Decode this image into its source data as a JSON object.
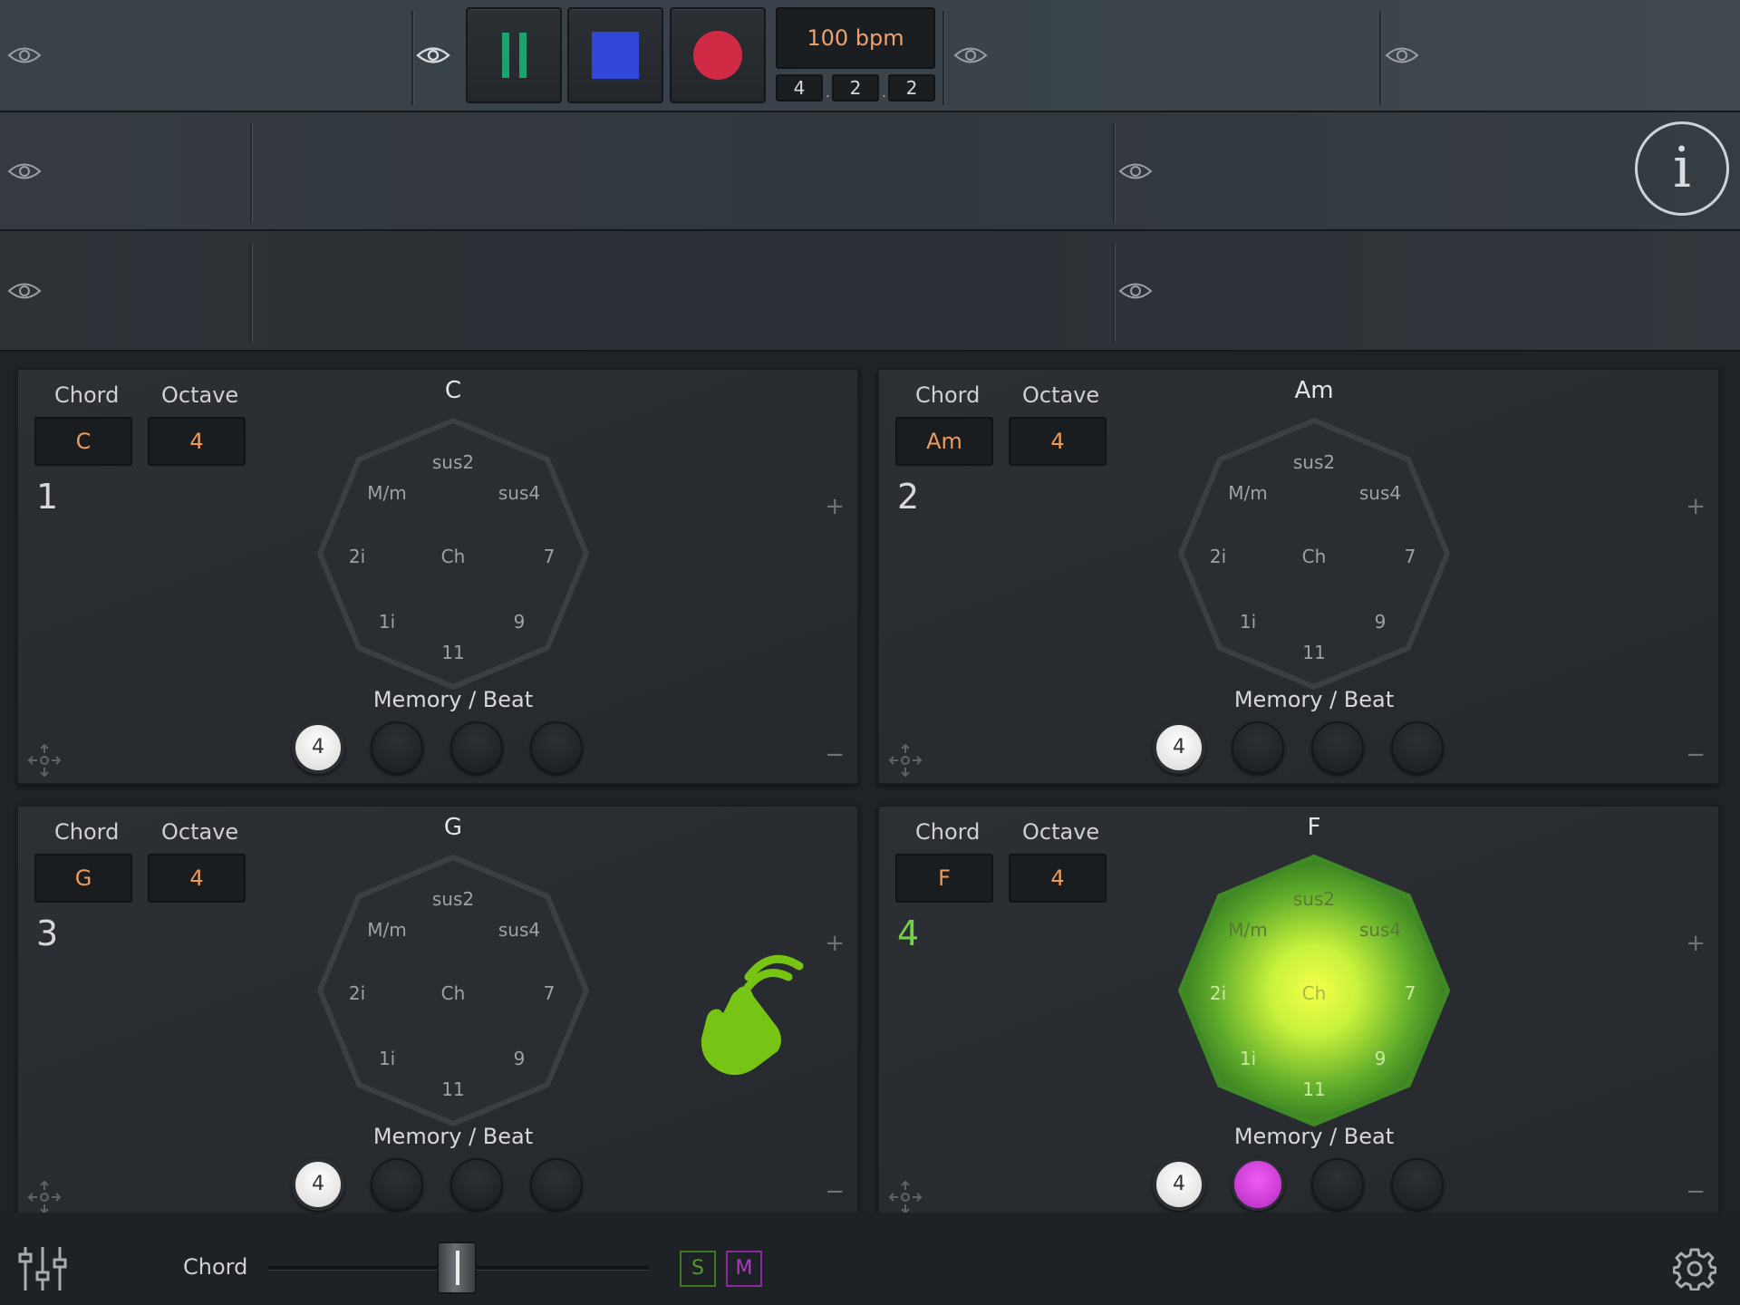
{
  "transport": {
    "bpm": "100 bpm",
    "position": [
      "4",
      "2",
      "2"
    ],
    "pause_label": "pause",
    "stop_label": "stop",
    "record_label": "record"
  },
  "info_label": "i",
  "panels": [
    {
      "number": "1",
      "title": "C",
      "chord": "C",
      "octave": "4",
      "chord_label": "Chord",
      "octave_label": "Octave",
      "memory_label": "Memory / Beat",
      "memory_value": "4",
      "active": false
    },
    {
      "number": "2",
      "title": "Am",
      "chord": "Am",
      "octave": "4",
      "chord_label": "Chord",
      "octave_label": "Octave",
      "memory_label": "Memory / Beat",
      "memory_value": "4",
      "active": false
    },
    {
      "number": "3",
      "title": "G",
      "chord": "G",
      "octave": "4",
      "chord_label": "Chord",
      "octave_label": "Octave",
      "memory_label": "Memory / Beat",
      "memory_value": "4",
      "active": false
    },
    {
      "number": "4",
      "title": "F",
      "chord": "F",
      "octave": "4",
      "chord_label": "Chord",
      "octave_label": "Octave",
      "memory_label": "Memory / Beat",
      "memory_value": "4",
      "active": true
    }
  ],
  "wheel_labels": {
    "top": "sus2",
    "upper_left": "M/m",
    "upper_right": "sus4",
    "left": "2i",
    "center": "Ch",
    "right": "7",
    "lower_left": "1i",
    "lower_right": "9",
    "bottom": "11"
  },
  "panel_controls": {
    "plus": "+",
    "minus": "−"
  },
  "bottom_bar": {
    "slider_label": "Chord",
    "solo_label": "S",
    "mute_label": "M"
  },
  "colors": {
    "accent_green": "#74d24a",
    "orange_value": "#f09a5a",
    "stop_blue": "#3047d8",
    "record_red": "#d02a44",
    "beat_magenta": "#d23fe0"
  },
  "icons": [
    "eye-icon",
    "pause-icon",
    "stop-icon",
    "record-icon",
    "info-icon",
    "move-icon",
    "mixer-icon",
    "gear-icon",
    "tap-hand-icon"
  ]
}
